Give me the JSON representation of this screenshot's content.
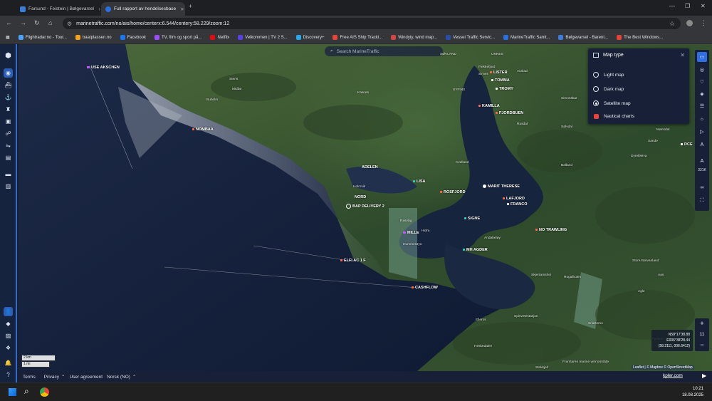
{
  "browser": {
    "tabs": [
      {
        "title": "Farsund - Feistein | Bølgevarsel"
      },
      {
        "title": "Full rapport av hendelsesbase"
      }
    ],
    "url": "marinetraffic.com/no/ais/home/centerx:6.544/centery:58.229/zoom:12",
    "bookmarks": [
      {
        "label": "Flightradar.no - Tour...",
        "color": "#4aa3ff"
      },
      {
        "label": "baatplassen.no",
        "color": "#f4a31f"
      },
      {
        "label": "Facebook",
        "color": "#1877f2"
      },
      {
        "label": "TV, film og sport på...",
        "color": "#9b4dff"
      },
      {
        "label": "Netflix",
        "color": "#e50914"
      },
      {
        "label": "Velkommen | TV 2 S...",
        "color": "#5a3ee6"
      },
      {
        "label": "Discovery+",
        "color": "#27a6e8"
      },
      {
        "label": "Free AIS Ship Tracki...",
        "color": "#e8433a"
      },
      {
        "label": "Windyty, wind map...",
        "color": "#d34444"
      },
      {
        "label": "Vessel Traffic Servic...",
        "color": "#2a4ea6"
      },
      {
        "label": "MarineTraffic Samt...",
        "color": "#2a6ee0"
      },
      {
        "label": "Bølgevarsel - Barent...",
        "color": "#3b7dd8"
      },
      {
        "label": "The Best Windows...",
        "color": "#e8433a"
      }
    ]
  },
  "search": {
    "placeholder": "Search MarineTraffic"
  },
  "map_type_panel": {
    "title": "Map type",
    "options": [
      {
        "label": "Light map",
        "selected": false
      },
      {
        "label": "Dark map",
        "selected": false
      },
      {
        "label": "Satellite map",
        "selected": true
      },
      {
        "label": "Nautical charts",
        "locked": true
      }
    ]
  },
  "vessels": [
    {
      "name": "USE AKSCHEN",
      "kind": "purple"
    },
    {
      "name": "NOMBAA",
      "kind": "red"
    },
    {
      "name": "ADELEN",
      "kind": "red"
    },
    {
      "name": "LISA",
      "kind": "cyan"
    },
    {
      "name": "ROSFJORD",
      "kind": "red"
    },
    {
      "name": "MARIT THERESE",
      "kind": "white"
    },
    {
      "name": "LAFJORD",
      "kind": "white"
    },
    {
      "name": "FRANCO",
      "kind": "white"
    },
    {
      "name": "NORD",
      "kind": "red"
    },
    {
      "name": "BAP DELIVERY 2",
      "kind": "white"
    },
    {
      "name": "SIGNE",
      "kind": "cyan"
    },
    {
      "name": "MILLE",
      "kind": "purple"
    },
    {
      "name": "MH AGDER",
      "kind": "cyan"
    },
    {
      "name": "NO TRAWLING",
      "kind": "red"
    },
    {
      "name": "ELFI AC 1 F",
      "kind": "red"
    },
    {
      "name": "CASHFLOW",
      "kind": "red"
    },
    {
      "name": "LISTER",
      "kind": "red"
    },
    {
      "name": "TOMMA",
      "kind": "white"
    },
    {
      "name": "TROMY",
      "kind": "white"
    },
    {
      "name": "KAMILLA",
      "kind": "red"
    },
    {
      "name": "FJORDBUEN",
      "kind": "red"
    },
    {
      "name": "DCE",
      "kind": "white"
    }
  ],
  "place_names": [
    "Stens",
    "Midbø",
    "Buholm",
    "Kasnes",
    "Flekkefjord",
    "Sirnes",
    "SØVLAND",
    "UNNES",
    "Auslad",
    "SYFINS",
    "Simonskar",
    "Rusdal",
    "Sølvdal",
    "Mønsdal",
    "Kvelland",
    "Holmvik",
    "Sande",
    "Dyrekleiva",
    "Balland",
    "Andabeløy",
    "Hidra",
    "Rasvåg",
    "Hummerøyo",
    "Skjerramshei",
    "Rogalholen",
    "Spivvetestasjon",
    "Elleros",
    "Snartemo",
    "Aas",
    "Store Børvanland",
    "Agle",
    "Fjellum",
    "Framtaren marine vernområde",
    "Heskedalen",
    "Stokkjell"
  ],
  "right_toolbar": {
    "vessel_count": "331K"
  },
  "zoom": {
    "level": "11",
    "plus": "+",
    "minus": "−"
  },
  "coordinates": {
    "lat": "N58°17'38.88",
    "lon": "E006°38'28.44",
    "decimal": "(58.2111, 006.6412)"
  },
  "attribution": {
    "leaflet": "Leaflet",
    "map": "© Mapbox © OpenStreetMap"
  },
  "scale": {
    "km": "2 km",
    "mi": "1 mi"
  },
  "footer": {
    "items": [
      "Terms",
      "Privacy",
      "User agreement",
      "Norsk (NO)"
    ],
    "kpler": "kpler.com"
  },
  "taskbar": {
    "time": "10:21",
    "date": "18.08.2025"
  }
}
